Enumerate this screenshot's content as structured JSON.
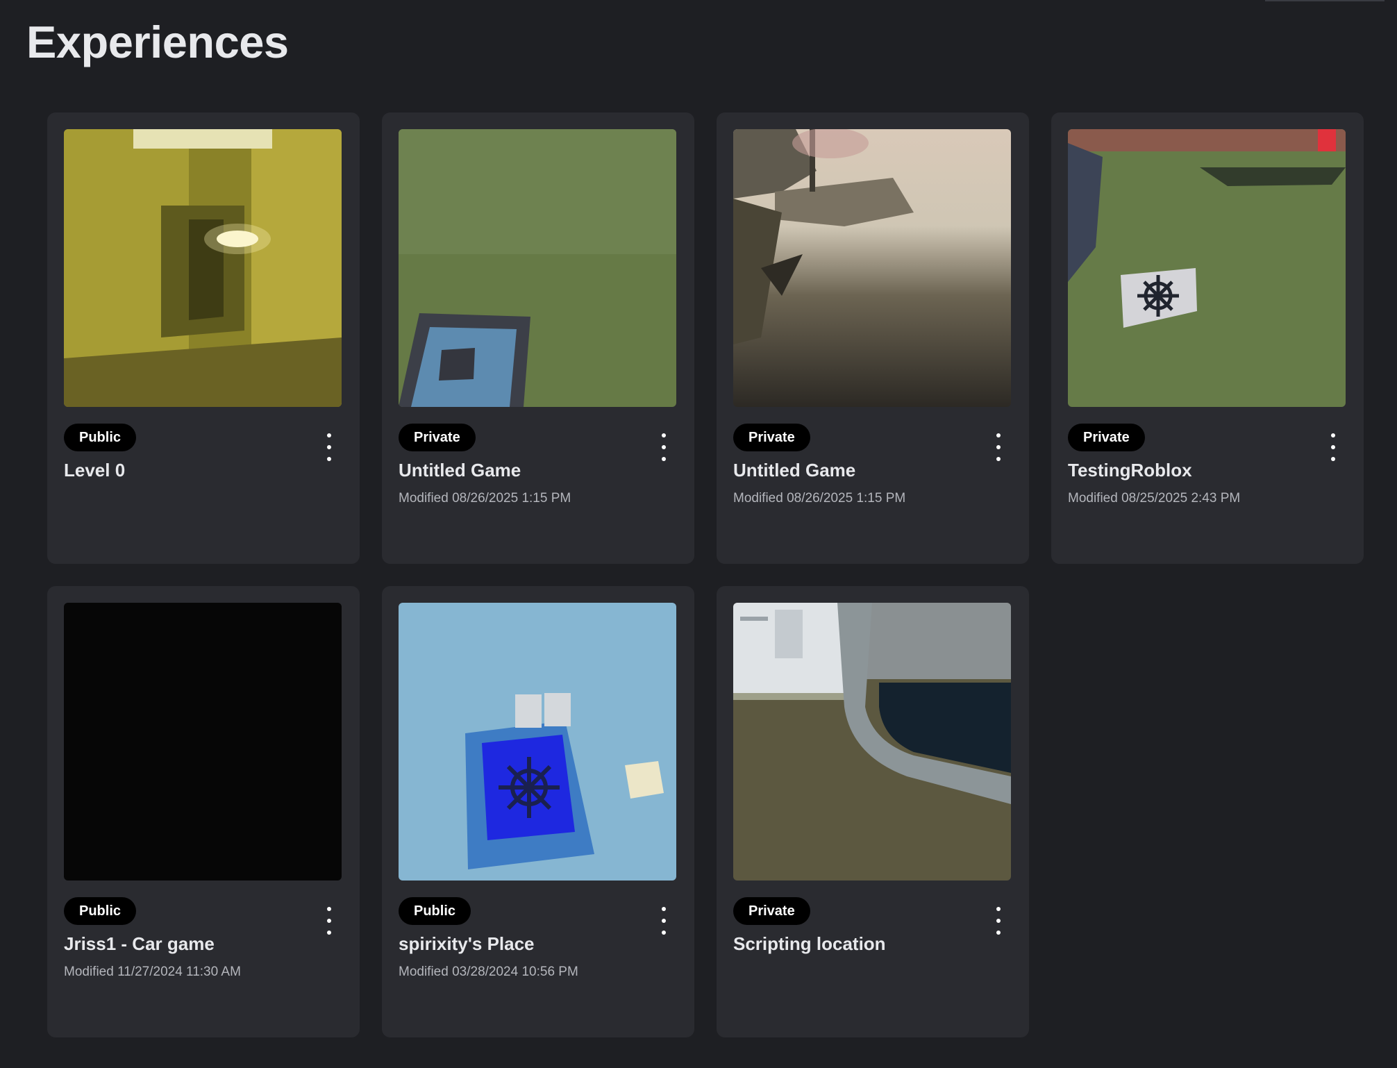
{
  "page": {
    "title": "Experiences"
  },
  "experiences": [
    {
      "status": "Public",
      "title": "Level 0",
      "modified": "",
      "thumbnail": "backrooms-hallway"
    },
    {
      "status": "Private",
      "title": "Untitled Game",
      "modified": "Modified 08/26/2025 1:15 PM",
      "thumbnail": "grass-baseplate"
    },
    {
      "status": "Private",
      "title": "Untitled Game",
      "modified": "Modified 08/26/2025 1:15 PM",
      "thumbnail": "cliff-landscape"
    },
    {
      "status": "Private",
      "title": "TestingRoblox",
      "modified": "Modified 08/25/2025 2:43 PM",
      "thumbnail": "grass-decal"
    },
    {
      "status": "Public",
      "title": "Jriss1 - Car game",
      "modified": "Modified 11/27/2024 11:30 AM",
      "thumbnail": "black-scene"
    },
    {
      "status": "Public",
      "title": "spirixity's Place",
      "modified": "Modified 03/28/2024 10:56 PM",
      "thumbnail": "blue-spawn"
    },
    {
      "status": "Private",
      "title": "Scripting location",
      "modified": "",
      "thumbnail": "interior-room"
    }
  ],
  "colors": {
    "background": "#1e1f23",
    "card": "#2a2b30",
    "badge": "#000000",
    "title_text": "#e8e9ec",
    "meta_text": "#b4b6bc"
  },
  "icons": {
    "card_menu": "more-vertical-icon"
  }
}
